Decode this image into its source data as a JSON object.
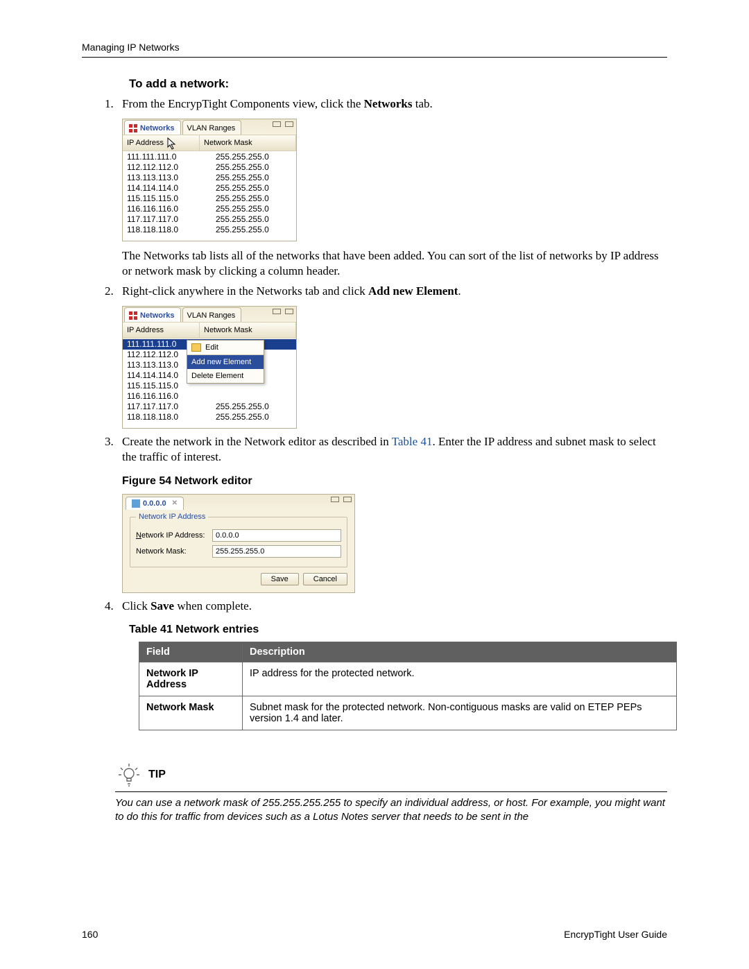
{
  "header": {
    "running": "Managing IP Networks"
  },
  "section": {
    "title": "To add a network:"
  },
  "steps": {
    "s1a": "From the EncrypTight Components view, click the ",
    "s1b": "Networks",
    "s1c": " tab.",
    "s1_post_a": "The Networks tab lists all of the networks that have been added. You can sort of the list of networks by IP address or network mask by clicking a column header.",
    "s2a": "Right-click anywhere in the Networks tab and click ",
    "s2b": "Add new Element",
    "s3a": "Create the network in the Network editor as described in ",
    "s3b": "Table 41",
    "s3c": ". Enter the IP address and subnet mask to select the traffic of interest.",
    "s4a": "Click ",
    "s4b": "Save",
    "s4c": " when complete."
  },
  "panel": {
    "tabs": {
      "networks": "Networks",
      "vlan": "VLAN Ranges"
    },
    "cols": {
      "ip": "IP Address",
      "mask": "Network Mask"
    },
    "rows": [
      {
        "ip": "111.111.111.0",
        "mask": "255.255.255.0"
      },
      {
        "ip": "112.112.112.0",
        "mask": "255.255.255.0"
      },
      {
        "ip": "113.113.113.0",
        "mask": "255.255.255.0"
      },
      {
        "ip": "114.114.114.0",
        "mask": "255.255.255.0"
      },
      {
        "ip": "115.115.115.0",
        "mask": "255.255.255.0"
      },
      {
        "ip": "116.116.116.0",
        "mask": "255.255.255.0"
      },
      {
        "ip": "117.117.117.0",
        "mask": "255.255.255.0"
      },
      {
        "ip": "118.118.118.0",
        "mask": "255.255.255.0"
      }
    ]
  },
  "contextMenu": {
    "edit": "Edit",
    "add": "Add new Element",
    "delete": "Delete Element"
  },
  "figure54": "Figure 54    Network editor",
  "editor": {
    "tab": "0.0.0.0",
    "group": "Network IP Address",
    "ipLabelPre": "N",
    "ipLabelPost": "etwork IP Address:",
    "ipValue": "0.0.0.0",
    "maskLabel": "Network Mask:",
    "maskValue": "255.255.255.0",
    "save": "Save",
    "cancel": "Cancel"
  },
  "table41": {
    "caption": "Table 41     Network entries",
    "headers": {
      "field": "Field",
      "desc": "Description"
    },
    "rows": [
      {
        "field": "Network IP Address",
        "desc": "IP address for the protected network."
      },
      {
        "field": "Network Mask",
        "desc": "Subnet mask for the protected network. Non-contiguous masks are valid on ETEP PEPs version 1.4 and later."
      }
    ]
  },
  "tip": {
    "label": "TIP",
    "text": "You can use a network mask of 255.255.255.255 to specify an individual address, or host. For example, you might want to do this for traffic from devices such as a Lotus Notes server that needs to be sent in the"
  },
  "footer": {
    "page": "160",
    "doc": "EncrypTight User Guide"
  }
}
